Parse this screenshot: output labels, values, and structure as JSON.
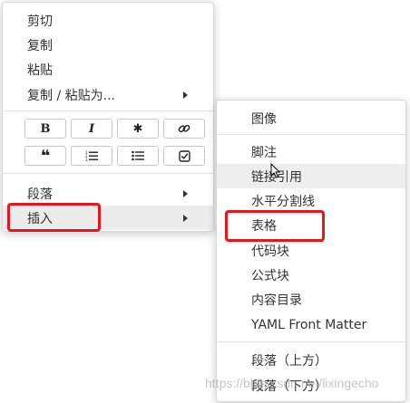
{
  "main_menu": {
    "items": [
      {
        "label": "剪切"
      },
      {
        "label": "复制"
      },
      {
        "label": "粘贴"
      },
      {
        "label": "复制 / 粘贴为..."
      }
    ],
    "format_row1": [
      "B",
      "I",
      "✱",
      "link"
    ],
    "format_row2": [
      "quote",
      "ordered-list",
      "unordered-list",
      "task-list"
    ],
    "paragraph": "段落",
    "insert": "插入"
  },
  "sub_menu": {
    "items": [
      {
        "label": "图像"
      },
      {
        "label": "脚注"
      },
      {
        "label": "链接引用"
      },
      {
        "label": "水平分割线"
      },
      {
        "label": "表格"
      },
      {
        "label": "代码块"
      },
      {
        "label": "公式块"
      },
      {
        "label": "内容目录"
      },
      {
        "label": "YAML Front Matter"
      },
      {
        "label": "段落（上方）"
      },
      {
        "label": "段落（下方）"
      }
    ]
  },
  "watermark": "https://blog.csdn.net/lixingecho",
  "colors": {
    "annotation_red": "#e8151b",
    "highlight": "#ececec"
  }
}
